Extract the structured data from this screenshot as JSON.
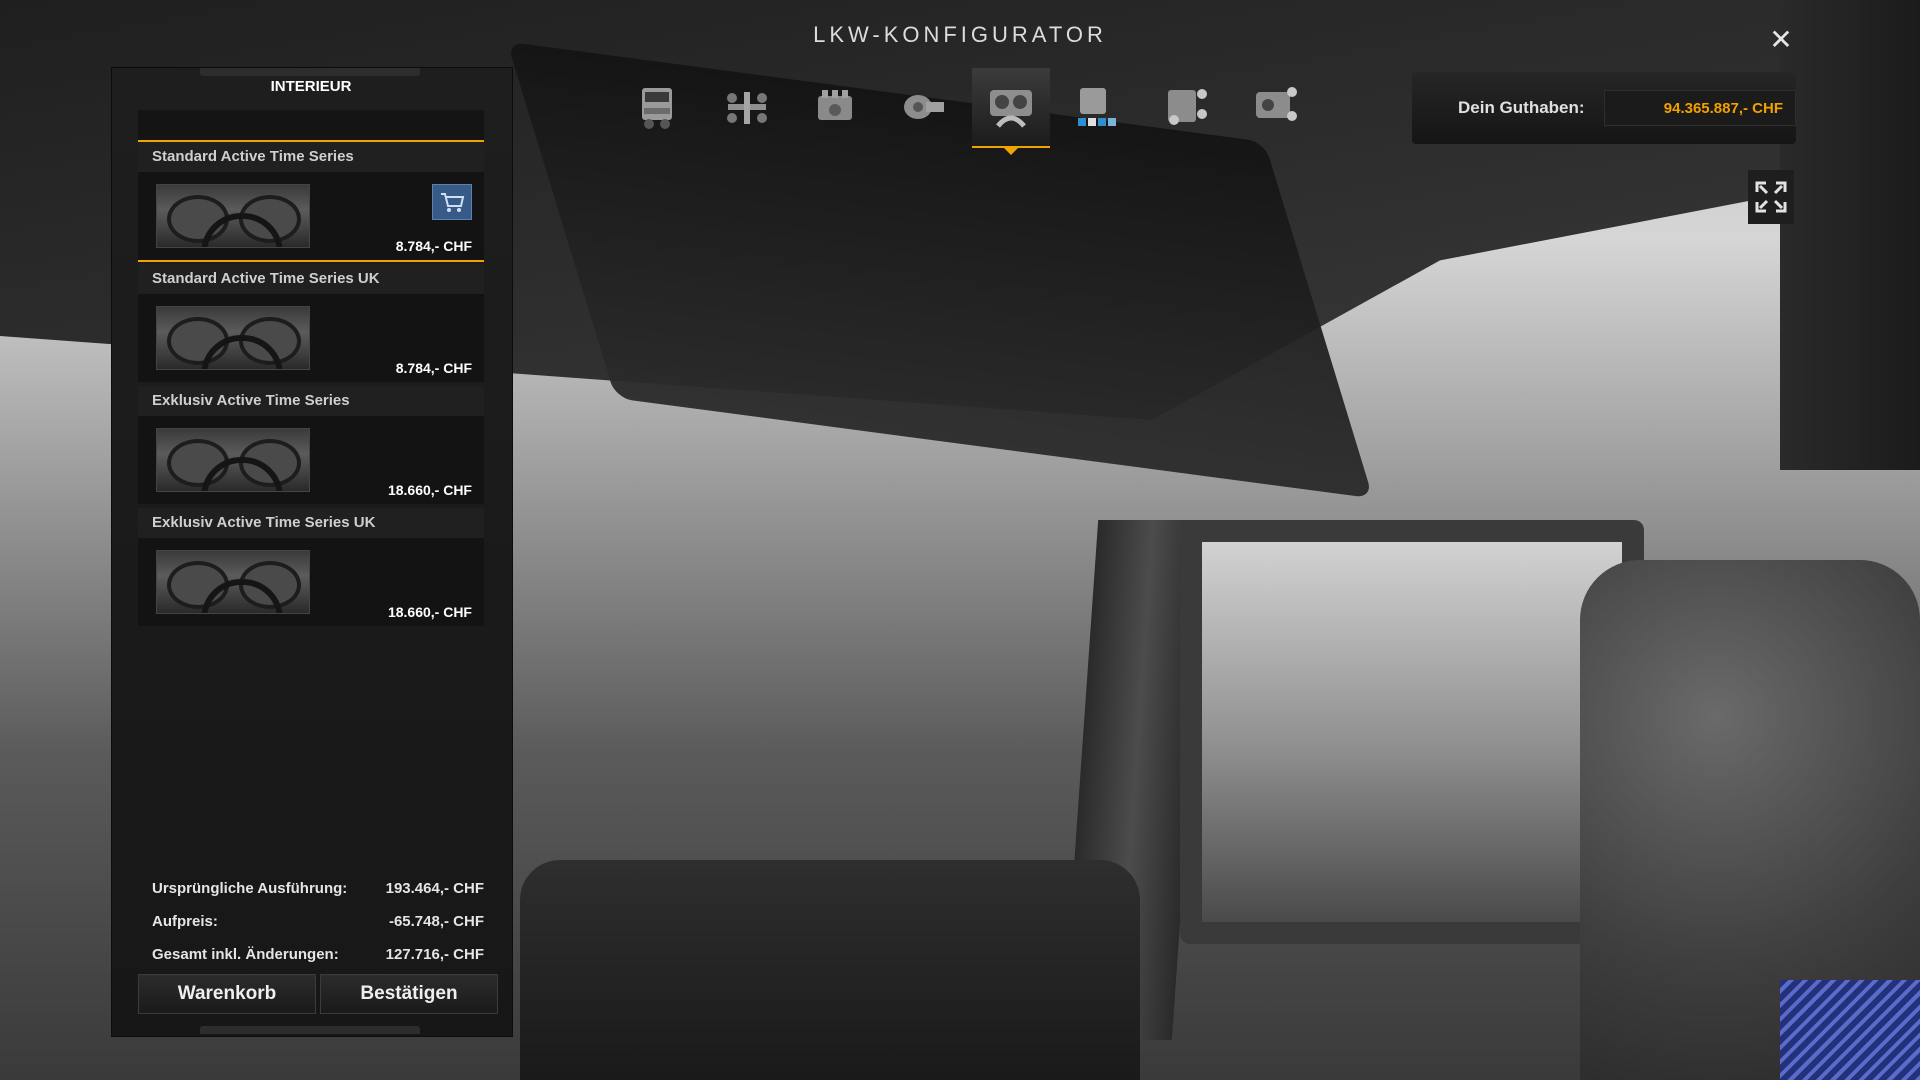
{
  "window": {
    "title": "LKW-KONFIGURATOR",
    "close_symbol": "✕"
  },
  "tabs": [
    {
      "icon": "truck-cab-icon",
      "active": false
    },
    {
      "icon": "chassis-icon",
      "active": false
    },
    {
      "icon": "engine-icon",
      "active": false
    },
    {
      "icon": "transmission-icon",
      "active": false
    },
    {
      "icon": "interior-icon",
      "active": true
    },
    {
      "icon": "paint-icon",
      "active": false
    },
    {
      "icon": "cabin-accessories-icon",
      "active": false
    },
    {
      "icon": "interior-accessories-icon",
      "active": false
    }
  ],
  "balance": {
    "label": "Dein Guthaben:",
    "value": "94.365.887,- CHF",
    "value_color": "#f2a000"
  },
  "panel": {
    "header": "INTERIEUR",
    "items": [
      {
        "name": "Standard Active Time Series",
        "price": "8.784,- CHF",
        "selected": true,
        "in_cart": true
      },
      {
        "name": "Standard Active Time Series UK",
        "price": "8.784,- CHF",
        "selected": false,
        "in_cart": false
      },
      {
        "name": "Exklusiv Active Time Series",
        "price": "18.660,- CHF",
        "selected": false,
        "in_cart": false
      },
      {
        "name": "Exklusiv Active Time Series UK",
        "price": "18.660,- CHF",
        "selected": false,
        "in_cart": false
      }
    ],
    "summary": [
      {
        "label": "Ursprüngliche Ausführung:",
        "value": "193.464,- CHF"
      },
      {
        "label": "Aufpreis:",
        "value": "-65.748,- CHF"
      },
      {
        "label": "Gesamt inkl. Änderungen:",
        "value": "127.716,- CHF"
      }
    ],
    "buttons": {
      "cart": "Warenkorb",
      "confirm": "Bestätigen"
    }
  },
  "colors": {
    "accent": "#f0a400",
    "cart_blue": "#375a86"
  }
}
